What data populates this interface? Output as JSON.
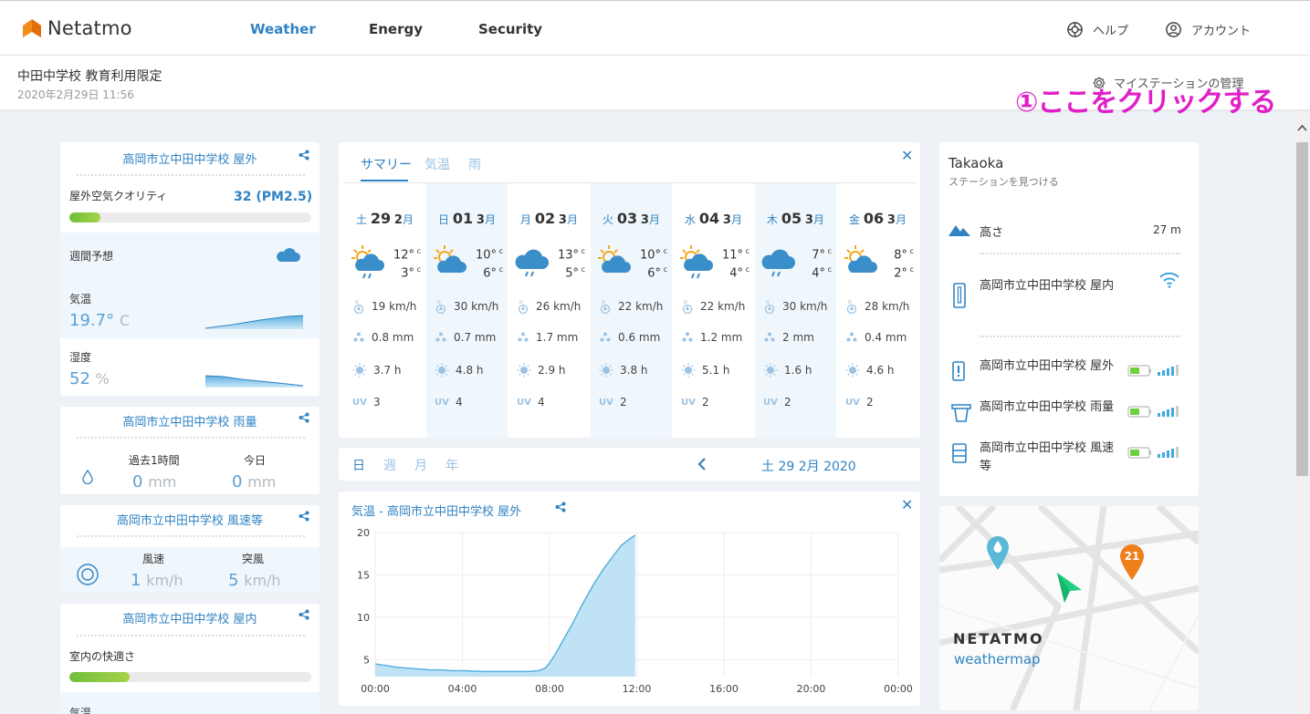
{
  "brand": {
    "name": "Netatmo",
    "accent": "#f28c1a"
  },
  "nav": {
    "tabs": [
      "Weather",
      "Energy",
      "Security"
    ],
    "help": "ヘルプ",
    "account": "アカウント"
  },
  "station": {
    "name": "中田中学校  教育利用限定",
    "datetime": "2020年2月29日 11:56",
    "manage": "マイステーションの管理"
  },
  "annotation": "①ここをクリックする",
  "outdoor": {
    "title": "高岡市立中田中学校  屋外",
    "air_label": "屋外空気クオリティ",
    "air_value": "32  (PM2.5)",
    "air_level": 0.13,
    "weekly_label": "週間予想",
    "temp_label": "気温",
    "temp_value": "19.7°",
    "temp_unit": "C",
    "humidity_label": "湿度",
    "humidity_value": "52",
    "humidity_unit": "%"
  },
  "rain": {
    "title": "高岡市立中田中学校  雨量",
    "past_label": "過去1時間",
    "today_label": "今日",
    "past_value": "0",
    "today_value": "0",
    "unit": "mm"
  },
  "wind": {
    "title": "高岡市立中田中学校  風速等",
    "speed_label": "風速",
    "gust_label": "突風",
    "speed_value": "1",
    "gust_value": "5",
    "unit": "km/h"
  },
  "indoor": {
    "title": "高岡市立中田中学校  屋内",
    "comfort_label": "室内の快適さ",
    "comfort_level": 0.25,
    "temp_label": "気温"
  },
  "forecast": {
    "tabs": [
      "サマリー",
      "気温",
      "雨"
    ],
    "days": [
      {
        "dow": "土",
        "day": "29",
        "mon": "2",
        "hi": "12°",
        "lo": "3°",
        "wind": "19 km/h",
        "rain": "0.8 mm",
        "sun": "3.7 h",
        "uv": "3",
        "icon": "partly-sunny-rain"
      },
      {
        "dow": "日",
        "day": "01",
        "mon": "3",
        "hi": "10°",
        "lo": "6°",
        "wind": "30 km/h",
        "rain": "0.7 mm",
        "sun": "4.8 h",
        "uv": "4",
        "icon": "partly-cloudy"
      },
      {
        "dow": "月",
        "day": "02",
        "mon": "3",
        "hi": "13°",
        "lo": "5°",
        "wind": "26 km/h",
        "rain": "1.7 mm",
        "sun": "2.9 h",
        "uv": "4",
        "icon": "cloud-rain"
      },
      {
        "dow": "火",
        "day": "03",
        "mon": "3",
        "hi": "10°",
        "lo": "6°",
        "wind": "22 km/h",
        "rain": "0.6 mm",
        "sun": "3.8 h",
        "uv": "2",
        "icon": "partly-cloudy"
      },
      {
        "dow": "水",
        "day": "04",
        "mon": "3",
        "hi": "11°",
        "lo": "4°",
        "wind": "22 km/h",
        "rain": "1.2 mm",
        "sun": "5.1 h",
        "uv": "2",
        "icon": "partly-sunny-rain"
      },
      {
        "dow": "木",
        "day": "05",
        "mon": "3",
        "hi": "7°",
        "lo": "4°",
        "wind": "30 km/h",
        "rain": "2 mm",
        "sun": "1.6 h",
        "uv": "2",
        "icon": "cloud-rain"
      },
      {
        "dow": "金",
        "day": "06",
        "mon": "3",
        "hi": "8°",
        "lo": "2°",
        "wind": "28 km/h",
        "rain": "0.4 mm",
        "sun": "4.6 h",
        "uv": "2",
        "icon": "partly-cloudy"
      }
    ],
    "deg_unit": "c",
    "month_suffix": "月",
    "uv_label": "UV"
  },
  "period": {
    "tabs": [
      "日",
      "週",
      "月",
      "年"
    ],
    "current": "土 29 2月 2020"
  },
  "chart_data": {
    "type": "area",
    "title": "気温 -  高岡市立中田中学校  屋外",
    "x_ticks": [
      "00:00",
      "04:00",
      "08:00",
      "12:00",
      "16:00",
      "20:00",
      "00:00"
    ],
    "y_ticks": [
      "5",
      "10",
      "15",
      "20"
    ],
    "xlim": [
      0,
      24
    ],
    "ylim": [
      3,
      20
    ],
    "x": [
      0,
      0.5,
      1,
      1.5,
      2,
      2.5,
      3,
      3.5,
      4,
      5,
      6,
      7,
      7.5,
      7.8,
      8,
      8.3,
      8.6,
      9,
      9.5,
      10,
      10.5,
      11,
      11.3,
      11.6,
      11.93
    ],
    "y": [
      4.5,
      4.3,
      4.1,
      4.0,
      3.9,
      3.8,
      3.8,
      3.7,
      3.7,
      3.6,
      3.6,
      3.6,
      3.7,
      4.0,
      4.6,
      5.8,
      7.2,
      9.0,
      11.5,
      13.8,
      15.8,
      17.5,
      18.5,
      19.1,
      19.7
    ],
    "color": "#5ab1e0"
  },
  "location": {
    "city": "Takaoka",
    "find": "ステーションを見つける",
    "altitude_label": "高さ",
    "altitude": "27 m",
    "modules": [
      "高岡市立中田中学校  屋内",
      "高岡市立中田中学校  屋外",
      "高岡市立中田中学校  雨量",
      "高岡市立中田中学校  風速等"
    ]
  },
  "weathermap": {
    "brand": "NETATMO",
    "sub": "weathermap",
    "pin_count": "21"
  }
}
